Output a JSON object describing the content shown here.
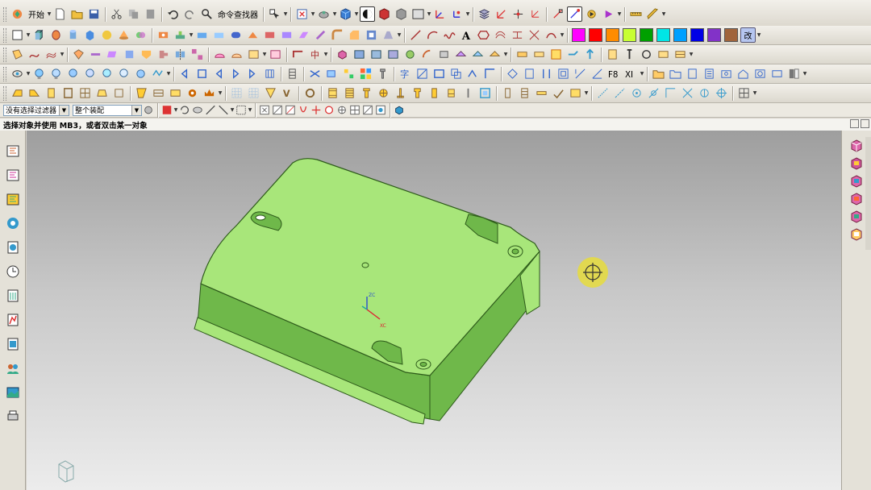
{
  "toolbar": {
    "start_label": "开始",
    "command_finder_label": "命令查找器",
    "layer_label": "改"
  },
  "filter_bar": {
    "selection_filter": "没有选择过滤器",
    "assembly_scope": "整个装配"
  },
  "cue_line": "选择对象并使用 MB3，或者双击某一对象",
  "viewport": {
    "wcs_z_label": "ZC",
    "wcs_x_label": "XC",
    "model_color": "#a8e67a",
    "model_dark_color": "#6fb84a",
    "model_edge_color": "#2d5a1a",
    "cursor_color": "#e6dc3c"
  },
  "colors": {
    "swatches": [
      "#ff00ff",
      "#ff0000",
      "#ff8c00",
      "#c8ff32",
      "#00a000",
      "#00e6e6",
      "#00a0ff",
      "#0000e6",
      "#8232c8",
      "#a0643c"
    ]
  }
}
